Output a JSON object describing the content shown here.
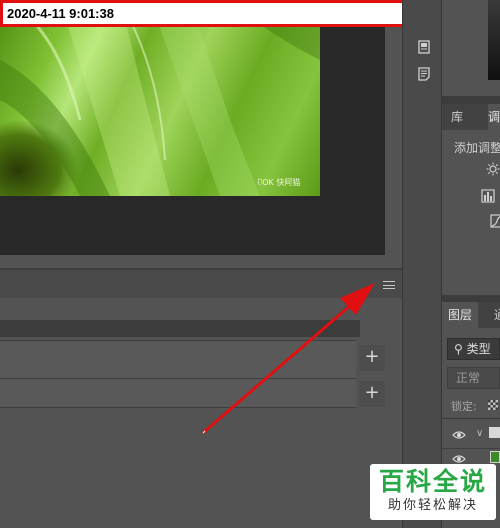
{
  "timestamp": "2020-4-11 9:01:38",
  "canvas": {
    "watermark": "ꀀOK 快阿猫"
  },
  "timeline": {
    "track_add_label": "+"
  },
  "right_panels": {
    "tabs_top": [
      {
        "label": "库"
      },
      {
        "label": "调"
      }
    ],
    "adjustments_title": "添加调整",
    "adjustment_icons": [
      "brightness-icon",
      "levels-icon",
      "curves-icon"
    ],
    "tabs_layers": [
      {
        "label": "图层"
      },
      {
        "label": "通"
      }
    ],
    "layer_filter": "类型",
    "blend_mode": "正常",
    "lock_label": "锁定:"
  },
  "icons": {
    "panel_menu": "hamburger-menu-icon",
    "properties": "properties-icon",
    "notes": "notes-icon",
    "eye": "eye-icon",
    "search": "search-icon"
  },
  "colors": {
    "arrow": "#e01010",
    "timestamp_border": "#e01010",
    "brand_green": "#27a844"
  },
  "brand": {
    "title": "百科全说",
    "subtitle": "助你轻松解决"
  }
}
